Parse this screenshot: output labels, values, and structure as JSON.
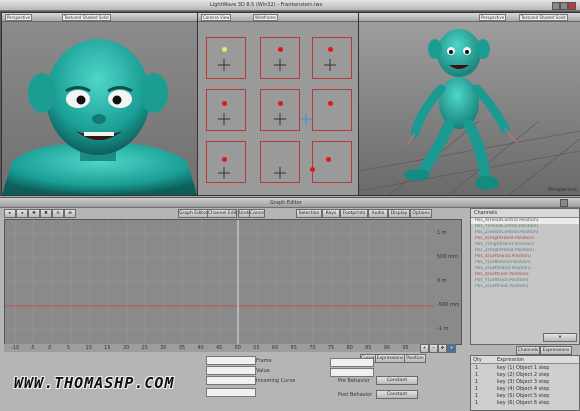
{
  "app": {
    "title": "LightWave 3D 8.5 (Win32) - Frankenstein.lws"
  },
  "viewports": {
    "left_label": "Perspective",
    "left_mode": "Textured Shaded Solid",
    "center_label": "Camera View",
    "center_mode": "Wireframe",
    "right_label": "Perspective",
    "right_mode": "Textured Shaded Solid",
    "bottom_status": "Perspective"
  },
  "graph_editor": {
    "title": "Graph Editor",
    "toolbar_left": [
      "Graph Editor",
      "Channel Edit"
    ],
    "toolbar_right": [
      "Selection",
      "Keys",
      "Footprints",
      "Audio",
      "Display",
      "Options",
      "Undo",
      "Cancel"
    ],
    "y_ticks": [
      "1 m",
      "500 mm",
      "0 m",
      "-500 mm",
      "-1 m"
    ],
    "x_ticks": [
      "-10",
      "-5",
      "0",
      "5",
      "10",
      "15",
      "20",
      "25",
      "30",
      "35",
      "40",
      "45",
      "50",
      "55",
      "60",
      "65",
      "70",
      "75",
      "80",
      "85",
      "90",
      "95",
      "100"
    ],
    "channels_header": "Channels",
    "channels": [
      "Pos_X(HeadControl.Position)",
      "Pos_Y(HeadControl.Position)",
      "Pos_Z(HeadControl.Position)",
      "Pos_X(RightHand.Position)",
      "Pos_Y(RightHand.Position)",
      "Pos_Z(RightHand.Position)",
      "Pos_X(LeftHand.Position)",
      "Pos_Y(LeftHand.Position)",
      "Pos_Z(LeftHand.Position)",
      "Pos_X(LeftFoot.Position)",
      "Pos_Y(LeftFoot.Position)",
      "Pos_Z(LeftFoot.Position)"
    ],
    "bottom_tabs": [
      "Curves",
      "Expressions",
      "Position"
    ],
    "channel_tabs": [
      "Channels",
      "Expressions"
    ],
    "curve_fields": [
      "Frame",
      "Value",
      "Incoming Curve",
      "Pre Behavior",
      "Post Behavior"
    ],
    "pre_behavior": "Constant",
    "post_behavior": "Constant",
    "expr_columns": [
      "Qty",
      "Expression"
    ],
    "expressions": [
      "key (1) Object 1 step",
      "key (2) Object 2 step",
      "key (3) Object 3 step",
      "key (4) Object 4 step",
      "key (5) Object 5 step",
      "key (6) Object 6 step"
    ],
    "expr_qty": [
      "1",
      "1",
      "1",
      "1",
      "1",
      "1"
    ],
    "add_button": "Add"
  },
  "watermark": "WWW.THOMASHP.COM"
}
